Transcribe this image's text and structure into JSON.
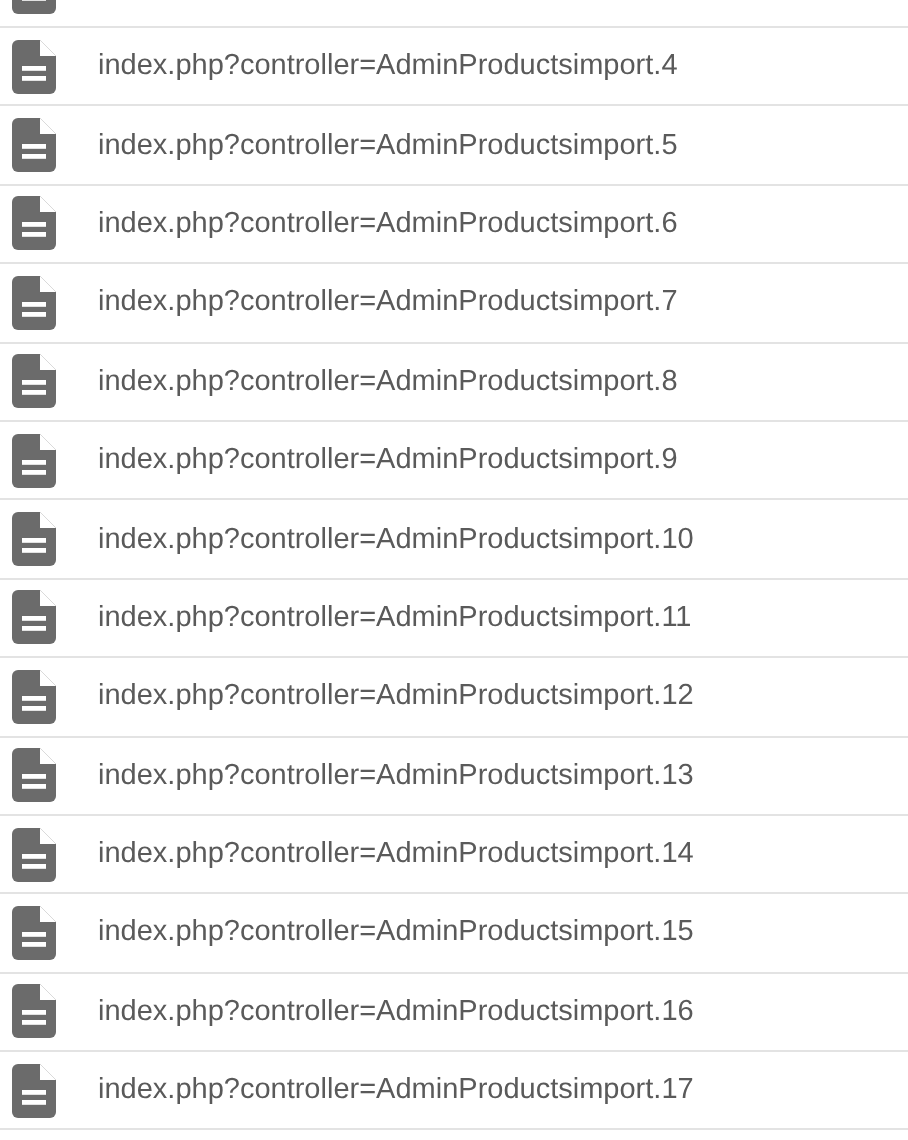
{
  "files": [
    {
      "label": "index.php?controller=AdminProductsimport.4"
    },
    {
      "label": "index.php?controller=AdminProductsimport.5"
    },
    {
      "label": "index.php?controller=AdminProductsimport.6"
    },
    {
      "label": "index.php?controller=AdminProductsimport.7"
    },
    {
      "label": "index.php?controller=AdminProductsimport.8"
    },
    {
      "label": "index.php?controller=AdminProductsimport.9"
    },
    {
      "label": "index.php?controller=AdminProductsimport.10"
    },
    {
      "label": "index.php?controller=AdminProductsimport.11"
    },
    {
      "label": "index.php?controller=AdminProductsimport.12"
    },
    {
      "label": "index.php?controller=AdminProductsimport.13"
    },
    {
      "label": "index.php?controller=AdminProductsimport.14"
    },
    {
      "label": "index.php?controller=AdminProductsimport.15"
    },
    {
      "label": "index.php?controller=AdminProductsimport.16"
    },
    {
      "label": "index.php?controller=AdminProductsimport.17"
    }
  ]
}
